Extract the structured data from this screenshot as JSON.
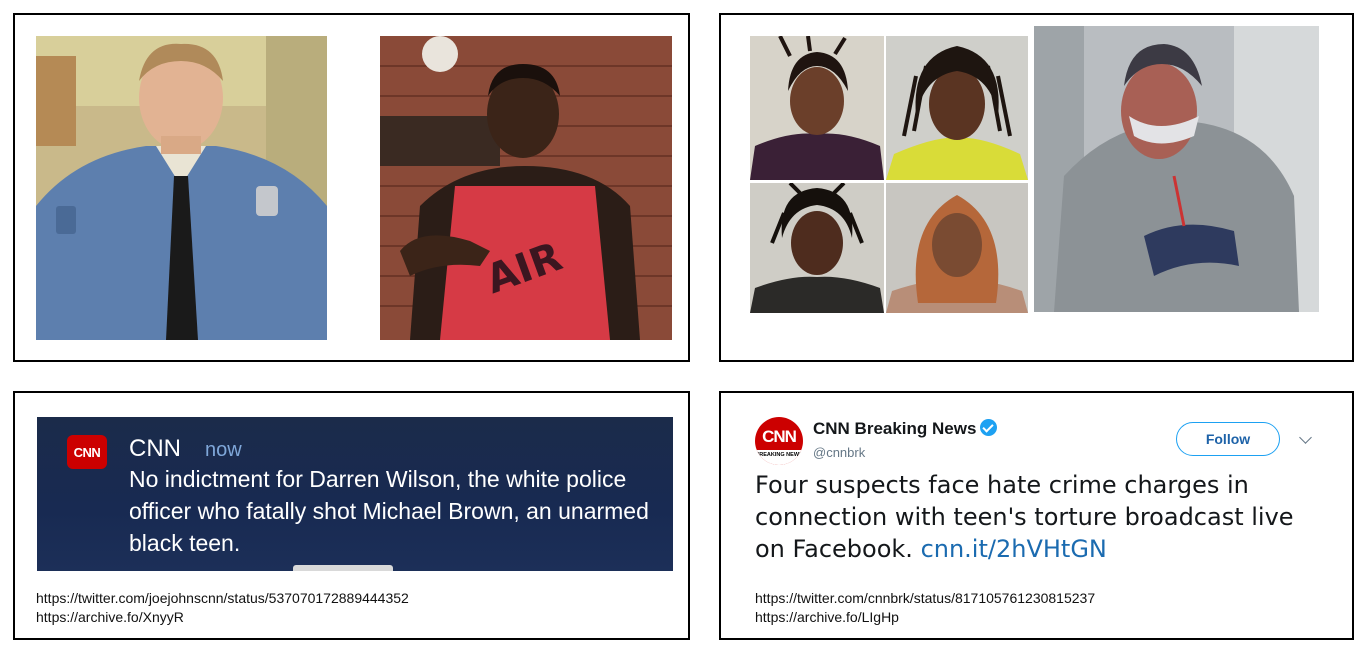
{
  "colors": {
    "cnn_red": "#cc0000",
    "twitter_blue": "#1da1f2",
    "link_blue": "#1b6bb0",
    "alert_bg": "#1b2b4a"
  },
  "panel_top_left": {
    "photos": [
      {
        "icon": "officer-portrait-photo"
      },
      {
        "icon": "teen-portrait-photo"
      }
    ]
  },
  "panel_top_right": {
    "photos": [
      {
        "icon": "mugshot-1-photo"
      },
      {
        "icon": "mugshot-2-photo"
      },
      {
        "icon": "mugshot-3-photo"
      },
      {
        "icon": "mugshot-4-photo"
      },
      {
        "icon": "video-still-photo"
      }
    ]
  },
  "cnn_alert": {
    "logo_text": "CNN",
    "app_name": "CNN",
    "time": "now",
    "message": "No indictment for Darren Wilson, the white police officer who fatally shot Michael Brown, an unarmed black teen.",
    "source_url": "https://twitter.com/joejohnscnn/status/537070172889444352",
    "archive_url": "https://archive.fo/XnyyR"
  },
  "tweet": {
    "avatar_logo": "CNN",
    "avatar_caption": "BREAKING NEWS",
    "account_name": "CNN Breaking News",
    "handle": "@cnnbrk",
    "follow_label": "Follow",
    "text": "Four suspects face hate crime charges in connection with teen's torture broadcast live on Facebook.",
    "link": "cnn.it/2hVHtGN",
    "source_url": "https://twitter.com/cnnbrk/status/817105761230815237",
    "archive_url": "https://archive.fo/LIgHp"
  }
}
